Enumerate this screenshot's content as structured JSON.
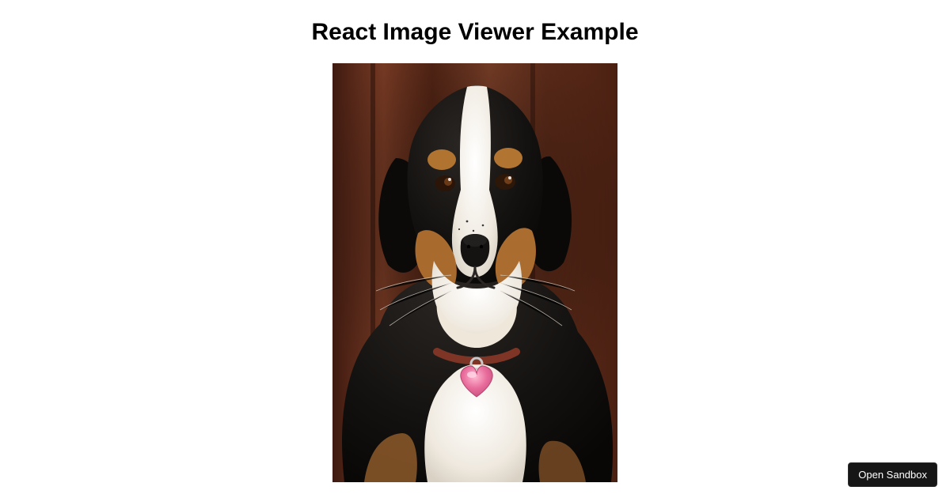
{
  "header": {
    "title": "React Image Viewer Example"
  },
  "main": {
    "image": {
      "subject": "dog",
      "description": "Portrait of a tricolor (black, white, tan) Swiss mountain-type dog with a pink heart-shaped tag, against a red-brown wooden background."
    }
  },
  "footer": {
    "open_sandbox_label": "Open Sandbox"
  },
  "palette": {
    "wood_dark": "#4a1f15",
    "wood_mid": "#7a3a24",
    "wood_light": "#9a553a",
    "fur_black": "#0f0d0c",
    "fur_tan": "#a86a2f",
    "fur_white": "#f3efe8",
    "tag_pink": "#e76a9a",
    "collar": "#8a3a2a"
  }
}
